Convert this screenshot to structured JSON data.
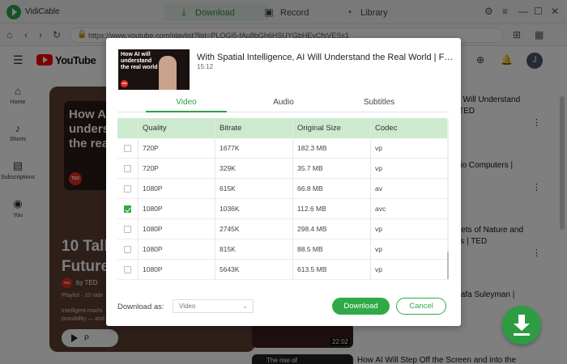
{
  "app": {
    "name": "VidiCable"
  },
  "nav_tabs": [
    {
      "label": "Download",
      "icon": "download-icon"
    },
    {
      "label": "Record",
      "icon": "record-icon"
    },
    {
      "label": "Library",
      "icon": "library-icon"
    }
  ],
  "address": {
    "url": "https://www.youtube.com/playlist?list=PLOGi5-fAu8bGh6HSUYGbHEvCfsVESs1"
  },
  "youtube": {
    "brand": "YouTube",
    "avatar_letter": "J",
    "sidebar": [
      {
        "label": "Home",
        "icon": "home-icon"
      },
      {
        "label": "Shorts",
        "icon": "shorts-icon"
      },
      {
        "label": "Subscriptions",
        "icon": "subscriptions-icon"
      },
      {
        "label": "You",
        "icon": "you-icon"
      }
    ],
    "playlist": {
      "thumb_text": "How AI will understand the real",
      "title_line1": "10 Talk",
      "title_line2": "Future",
      "by": "by TED",
      "meta": "Playlist · 10 vide",
      "desc_line1": "Intelligent machi",
      "desc_line2": "possibility — and",
      "play_label": "P",
      "ted": "TED"
    },
    "right_items": [
      {
        "line1": "I Will Understand",
        "line2": "TED"
      },
      {
        "line1": "lio Computers |",
        "line2": ""
      },
      {
        "line1": "rets of Nature and",
        "line2": "is | TED"
      },
      {
        "line1": "tafa Suleyman |",
        "line2": ""
      }
    ],
    "bottom_thumb_time": "22:02",
    "bottom_thumb2_text": "The rise of",
    "bottom_title": "How AI Will Step Off the Screen and into the"
  },
  "modal": {
    "title": "With Spatial Intelligence, AI Will Understand the Real World | Fei-Fei Li | TED",
    "duration": "15:12",
    "thumb_text": "How AI will understand the real world",
    "thumb_ted": "TED",
    "tabs": [
      "Video",
      "Audio",
      "Subtitles"
    ],
    "active_tab": "Video",
    "table": {
      "headers": [
        "Quality",
        "Bitrate",
        "Original Size",
        "Codec"
      ],
      "rows": [
        {
          "checked": false,
          "quality": "720P",
          "bitrate": "1677K",
          "size": "182.3 MB",
          "codec": "vp"
        },
        {
          "checked": false,
          "quality": "720P",
          "bitrate": "329K",
          "size": "35.7 MB",
          "codec": "vp"
        },
        {
          "checked": false,
          "quality": "1080P",
          "bitrate": "615K",
          "size": "66.8 MB",
          "codec": "av"
        },
        {
          "checked": true,
          "quality": "1080P",
          "bitrate": "1036K",
          "size": "112.6 MB",
          "codec": "avc"
        },
        {
          "checked": false,
          "quality": "1080P",
          "bitrate": "2745K",
          "size": "298.4 MB",
          "codec": "vp"
        },
        {
          "checked": false,
          "quality": "1080P",
          "bitrate": "815K",
          "size": "88.5 MB",
          "codec": "vp"
        },
        {
          "checked": false,
          "quality": "1080P",
          "bitrate": "5643K",
          "size": "613.5 MB",
          "codec": "vp"
        },
        {
          "checked": false,
          "quality": "1080P",
          "bitrate": "",
          "size": "",
          "codec": ""
        }
      ]
    },
    "download_as_label": "Download as:",
    "download_as_value": "Video",
    "download_button": "Download",
    "cancel_button": "Cancel"
  },
  "colors": {
    "accent": "#2faa47",
    "header_green": "#cde9cf",
    "overlay": "rgba(0,0,0,0.5)"
  }
}
